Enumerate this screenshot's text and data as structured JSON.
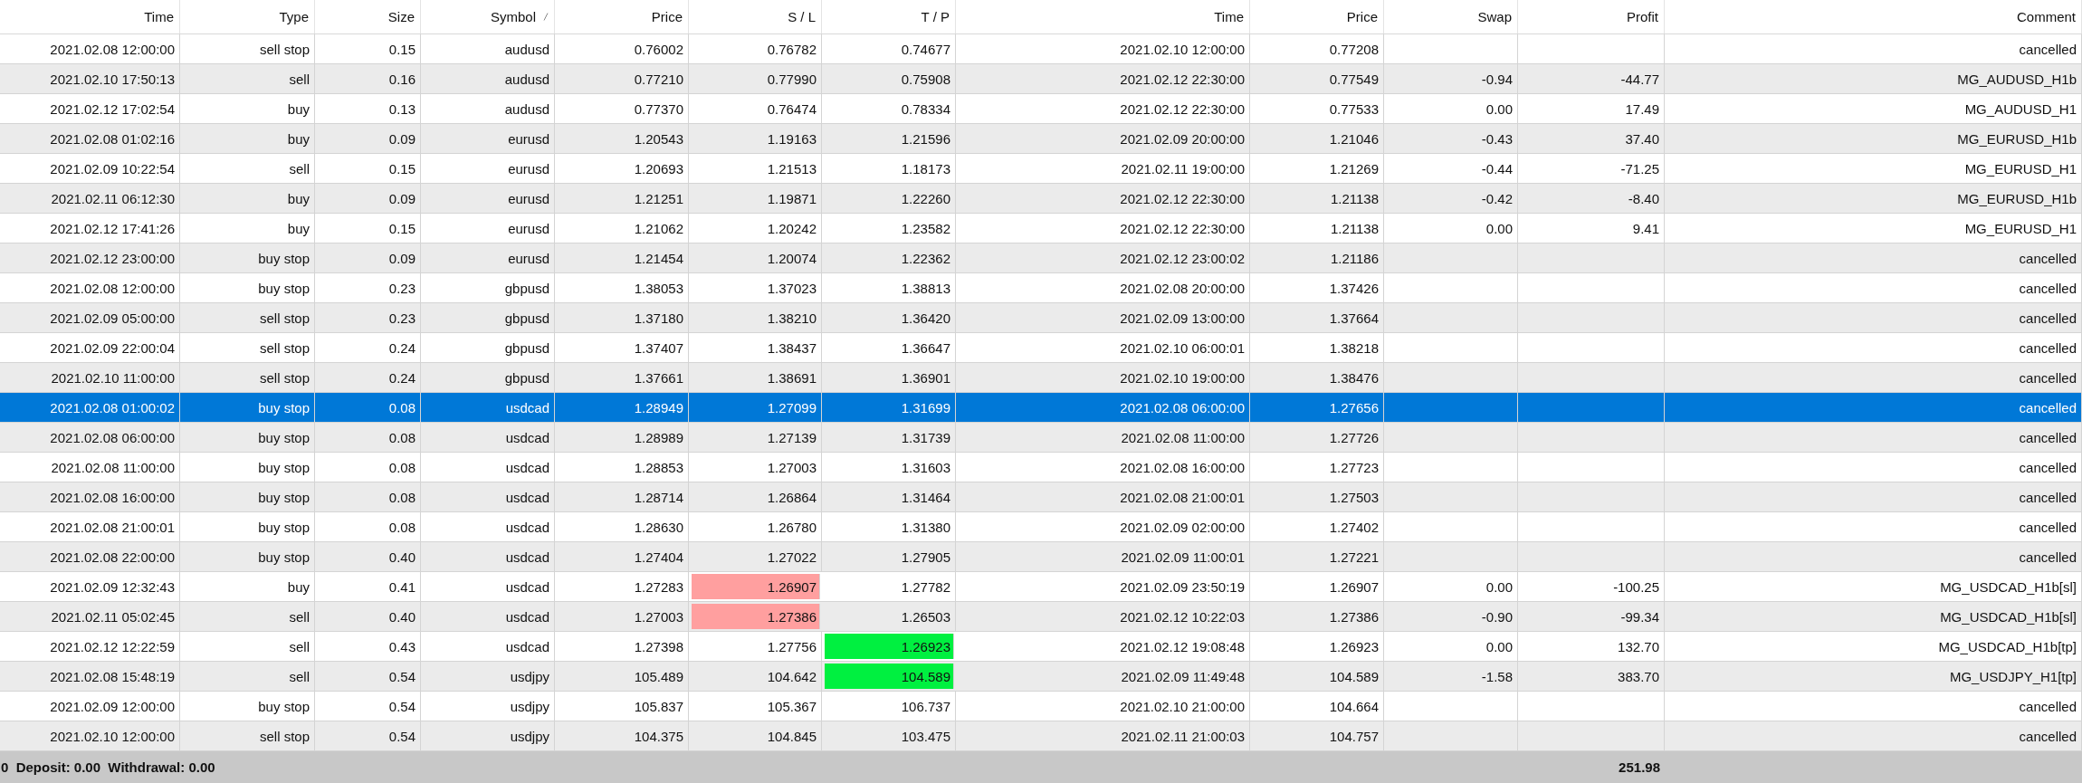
{
  "columns": [
    {
      "label": "Time",
      "sorted": false
    },
    {
      "label": "Type",
      "sorted": false
    },
    {
      "label": "Size",
      "sorted": false
    },
    {
      "label": "Symbol",
      "sorted": true
    },
    {
      "label": "Price",
      "sorted": false
    },
    {
      "label": "S / L",
      "sorted": false
    },
    {
      "label": "T / P",
      "sorted": false
    },
    {
      "label": "Time",
      "sorted": false
    },
    {
      "label": "Price",
      "sorted": false
    },
    {
      "label": "Swap",
      "sorted": false
    },
    {
      "label": "Profit",
      "sorted": false
    },
    {
      "label": "Comment",
      "sorted": false
    }
  ],
  "rows": [
    {
      "selected": false,
      "sl_hit": false,
      "tp_hit": false,
      "time": "2021.02.08 12:00:00",
      "type": "sell stop",
      "size": "0.15",
      "symbol": "audusd",
      "price": "0.76002",
      "sl": "0.76782",
      "tp": "0.74677",
      "close_time": "2021.02.10 12:00:00",
      "close_price": "0.77208",
      "comment": "cancelled"
    },
    {
      "selected": false,
      "sl_hit": false,
      "tp_hit": false,
      "time": "2021.02.10 17:50:13",
      "type": "sell",
      "size": "0.16",
      "symbol": "audusd",
      "price": "0.77210",
      "sl": "0.77990",
      "tp": "0.75908",
      "close_time": "2021.02.12 22:30:00",
      "close_price": "0.77549",
      "swap": "-0.94",
      "profit": "-44.77",
      "comment": "MG_AUDUSD_H1b"
    },
    {
      "selected": false,
      "sl_hit": false,
      "tp_hit": false,
      "time": "2021.02.12 17:02:54",
      "type": "buy",
      "size": "0.13",
      "symbol": "audusd",
      "price": "0.77370",
      "sl": "0.76474",
      "tp": "0.78334",
      "close_time": "2021.02.12 22:30:00",
      "close_price": "0.77533",
      "swap": "0.00",
      "profit": "17.49",
      "comment": "MG_AUDUSD_H1"
    },
    {
      "selected": false,
      "sl_hit": false,
      "tp_hit": false,
      "time": "2021.02.08 01:02:16",
      "type": "buy",
      "size": "0.09",
      "symbol": "eurusd",
      "price": "1.20543",
      "sl": "1.19163",
      "tp": "1.21596",
      "close_time": "2021.02.09 20:00:00",
      "close_price": "1.21046",
      "swap": "-0.43",
      "profit": "37.40",
      "comment": "MG_EURUSD_H1b"
    },
    {
      "selected": false,
      "sl_hit": false,
      "tp_hit": false,
      "time": "2021.02.09 10:22:54",
      "type": "sell",
      "size": "0.15",
      "symbol": "eurusd",
      "price": "1.20693",
      "sl": "1.21513",
      "tp": "1.18173",
      "close_time": "2021.02.11 19:00:00",
      "close_price": "1.21269",
      "swap": "-0.44",
      "profit": "-71.25",
      "comment": "MG_EURUSD_H1"
    },
    {
      "selected": false,
      "sl_hit": false,
      "tp_hit": false,
      "time": "2021.02.11 06:12:30",
      "type": "buy",
      "size": "0.09",
      "symbol": "eurusd",
      "price": "1.21251",
      "sl": "1.19871",
      "tp": "1.22260",
      "close_time": "2021.02.12 22:30:00",
      "close_price": "1.21138",
      "swap": "-0.42",
      "profit": "-8.40",
      "comment": "MG_EURUSD_H1b"
    },
    {
      "selected": false,
      "sl_hit": false,
      "tp_hit": false,
      "time": "2021.02.12 17:41:26",
      "type": "buy",
      "size": "0.15",
      "symbol": "eurusd",
      "price": "1.21062",
      "sl": "1.20242",
      "tp": "1.23582",
      "close_time": "2021.02.12 22:30:00",
      "close_price": "1.21138",
      "swap": "0.00",
      "profit": "9.41",
      "comment": "MG_EURUSD_H1"
    },
    {
      "selected": false,
      "sl_hit": false,
      "tp_hit": false,
      "time": "2021.02.12 23:00:00",
      "type": "buy stop",
      "size": "0.09",
      "symbol": "eurusd",
      "price": "1.21454",
      "sl": "1.20074",
      "tp": "1.22362",
      "close_time": "2021.02.12 23:00:02",
      "close_price": "1.21186",
      "comment": "cancelled"
    },
    {
      "selected": false,
      "sl_hit": false,
      "tp_hit": false,
      "time": "2021.02.08 12:00:00",
      "type": "buy stop",
      "size": "0.23",
      "symbol": "gbpusd",
      "price": "1.38053",
      "sl": "1.37023",
      "tp": "1.38813",
      "close_time": "2021.02.08 20:00:00",
      "close_price": "1.37426",
      "comment": "cancelled"
    },
    {
      "selected": false,
      "sl_hit": false,
      "tp_hit": false,
      "time": "2021.02.09 05:00:00",
      "type": "sell stop",
      "size": "0.23",
      "symbol": "gbpusd",
      "price": "1.37180",
      "sl": "1.38210",
      "tp": "1.36420",
      "close_time": "2021.02.09 13:00:00",
      "close_price": "1.37664",
      "comment": "cancelled"
    },
    {
      "selected": false,
      "sl_hit": false,
      "tp_hit": false,
      "time": "2021.02.09 22:00:04",
      "type": "sell stop",
      "size": "0.24",
      "symbol": "gbpusd",
      "price": "1.37407",
      "sl": "1.38437",
      "tp": "1.36647",
      "close_time": "2021.02.10 06:00:01",
      "close_price": "1.38218",
      "comment": "cancelled"
    },
    {
      "selected": false,
      "sl_hit": false,
      "tp_hit": false,
      "time": "2021.02.10 11:00:00",
      "type": "sell stop",
      "size": "0.24",
      "symbol": "gbpusd",
      "price": "1.37661",
      "sl": "1.38691",
      "tp": "1.36901",
      "close_time": "2021.02.10 19:00:00",
      "close_price": "1.38476",
      "comment": "cancelled"
    },
    {
      "selected": true,
      "sl_hit": false,
      "tp_hit": false,
      "time": "2021.02.08 01:00:02",
      "type": "buy stop",
      "size": "0.08",
      "symbol": "usdcad",
      "price": "1.28949",
      "sl": "1.27099",
      "tp": "1.31699",
      "close_time": "2021.02.08 06:00:00",
      "close_price": "1.27656",
      "comment": "cancelled"
    },
    {
      "selected": false,
      "sl_hit": false,
      "tp_hit": false,
      "time": "2021.02.08 06:00:00",
      "type": "buy stop",
      "size": "0.08",
      "symbol": "usdcad",
      "price": "1.28989",
      "sl": "1.27139",
      "tp": "1.31739",
      "close_time": "2021.02.08 11:00:00",
      "close_price": "1.27726",
      "comment": "cancelled"
    },
    {
      "selected": false,
      "sl_hit": false,
      "tp_hit": false,
      "time": "2021.02.08 11:00:00",
      "type": "buy stop",
      "size": "0.08",
      "symbol": "usdcad",
      "price": "1.28853",
      "sl": "1.27003",
      "tp": "1.31603",
      "close_time": "2021.02.08 16:00:00",
      "close_price": "1.27723",
      "comment": "cancelled"
    },
    {
      "selected": false,
      "sl_hit": false,
      "tp_hit": false,
      "time": "2021.02.08 16:00:00",
      "type": "buy stop",
      "size": "0.08",
      "symbol": "usdcad",
      "price": "1.28714",
      "sl": "1.26864",
      "tp": "1.31464",
      "close_time": "2021.02.08 21:00:01",
      "close_price": "1.27503",
      "comment": "cancelled"
    },
    {
      "selected": false,
      "sl_hit": false,
      "tp_hit": false,
      "time": "2021.02.08 21:00:01",
      "type": "buy stop",
      "size": "0.08",
      "symbol": "usdcad",
      "price": "1.28630",
      "sl": "1.26780",
      "tp": "1.31380",
      "close_time": "2021.02.09 02:00:00",
      "close_price": "1.27402",
      "comment": "cancelled"
    },
    {
      "selected": false,
      "sl_hit": false,
      "tp_hit": false,
      "time": "2021.02.08 22:00:00",
      "type": "buy stop",
      "size": "0.40",
      "symbol": "usdcad",
      "price": "1.27404",
      "sl": "1.27022",
      "tp": "1.27905",
      "close_time": "2021.02.09 11:00:01",
      "close_price": "1.27221",
      "comment": "cancelled"
    },
    {
      "selected": false,
      "sl_hit": true,
      "tp_hit": false,
      "time": "2021.02.09 12:32:43",
      "type": "buy",
      "size": "0.41",
      "symbol": "usdcad",
      "price": "1.27283",
      "sl": "1.26907",
      "tp": "1.27782",
      "close_time": "2021.02.09 23:50:19",
      "close_price": "1.26907",
      "swap": "0.00",
      "profit": "-100.25",
      "comment": "MG_USDCAD_H1b[sl]"
    },
    {
      "selected": false,
      "sl_hit": true,
      "tp_hit": false,
      "time": "2021.02.11 05:02:45",
      "type": "sell",
      "size": "0.40",
      "symbol": "usdcad",
      "price": "1.27003",
      "sl": "1.27386",
      "tp": "1.26503",
      "close_time": "2021.02.12 10:22:03",
      "close_price": "1.27386",
      "swap": "-0.90",
      "profit": "-99.34",
      "comment": "MG_USDCAD_H1b[sl]"
    },
    {
      "selected": false,
      "sl_hit": false,
      "tp_hit": true,
      "time": "2021.02.12 12:22:59",
      "type": "sell",
      "size": "0.43",
      "symbol": "usdcad",
      "price": "1.27398",
      "sl": "1.27756",
      "tp": "1.26923",
      "close_time": "2021.02.12 19:08:48",
      "close_price": "1.26923",
      "swap": "0.00",
      "profit": "132.70",
      "comment": "MG_USDCAD_H1b[tp]"
    },
    {
      "selected": false,
      "sl_hit": false,
      "tp_hit": true,
      "time": "2021.02.08 15:48:19",
      "type": "sell",
      "size": "0.54",
      "symbol": "usdjpy",
      "price": "105.489",
      "sl": "104.642",
      "tp": "104.589",
      "close_time": "2021.02.09 11:49:48",
      "close_price": "104.589",
      "swap": "-1.58",
      "profit": "383.70",
      "comment": "MG_USDJPY_H1[tp]"
    },
    {
      "selected": false,
      "sl_hit": false,
      "tp_hit": false,
      "time": "2021.02.09 12:00:00",
      "type": "buy stop",
      "size": "0.54",
      "symbol": "usdjpy",
      "price": "105.837",
      "sl": "105.367",
      "tp": "106.737",
      "close_time": "2021.02.10 21:00:00",
      "close_price": "104.664",
      "comment": "cancelled"
    },
    {
      "selected": false,
      "sl_hit": false,
      "tp_hit": false,
      "time": "2021.02.10 12:00:00",
      "type": "sell stop",
      "size": "0.54",
      "symbol": "usdjpy",
      "price": "104.375",
      "sl": "104.845",
      "tp": "103.475",
      "close_time": "2021.02.11 21:00:03",
      "close_price": "104.757",
      "comment": "cancelled"
    }
  ],
  "summary": {
    "text": "0  Deposit: 0.00  Withdrawal: 0.00",
    "profit_total": "251.98"
  }
}
